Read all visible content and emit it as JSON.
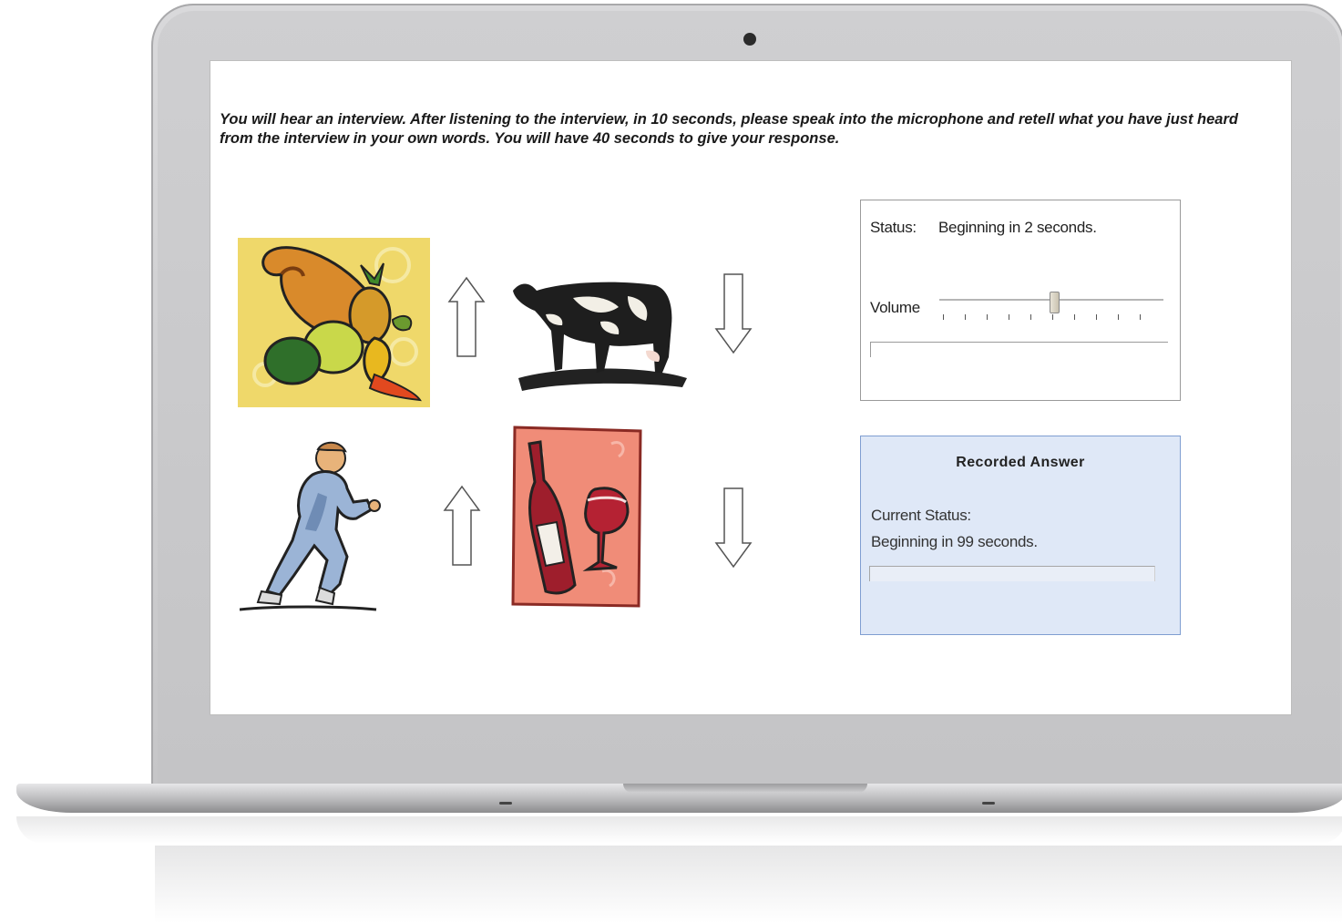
{
  "instructions": "You will hear an interview. After listening to the interview, in 10 seconds, please speak into the microphone and retell what you have just heard from the interview in your own words. You will have 40 seconds to give your response.",
  "pictures": [
    {
      "name": "cornucopia-picture"
    },
    {
      "name": "cow-picture"
    },
    {
      "name": "runner-picture"
    },
    {
      "name": "wine-picture"
    }
  ],
  "arrows": [
    "up-arrow-icon",
    "down-arrow-icon",
    "up-arrow-icon",
    "down-arrow-icon"
  ],
  "status_panel": {
    "status_label": "Status:",
    "status_text": "Beginning in 2 seconds.",
    "volume_label": "Volume",
    "volume_level": 0.5
  },
  "recorded_answer": {
    "title": "Recorded Answer",
    "current_status_label": "Current Status:",
    "status_text": "Beginning in 99 seconds."
  },
  "colors": {
    "recorded_panel_bg": "#dfe8f7",
    "recorded_panel_border": "#7f9ed1"
  }
}
